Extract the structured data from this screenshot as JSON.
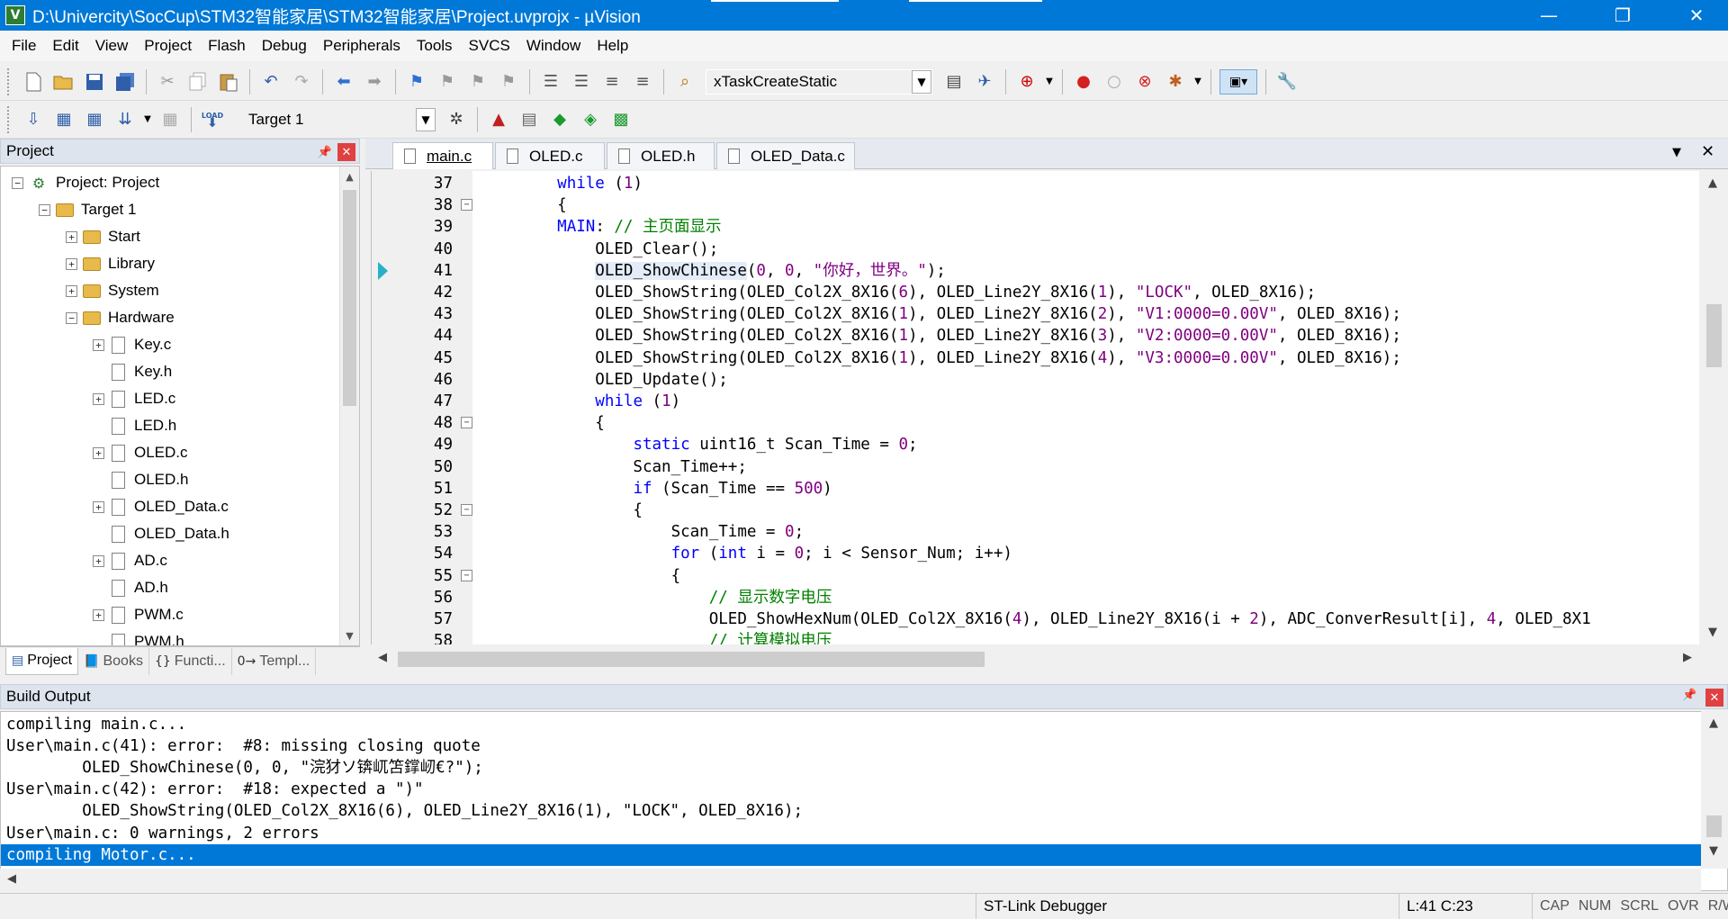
{
  "window": {
    "title": "D:\\Univercity\\SocCup\\STM32智能家居\\STM32智能家居\\Project.uvprojx - µVision",
    "logo_letter": "V",
    "minimize": "—",
    "restore": "❐",
    "close": "✕"
  },
  "menu": [
    "File",
    "Edit",
    "View",
    "Project",
    "Flash",
    "Debug",
    "Peripherals",
    "Tools",
    "SVCS",
    "Window",
    "Help"
  ],
  "toolbar1": {
    "find_combo_value": "xTaskCreateStatic"
  },
  "toolbar2": {
    "target_combo_value": "Target 1",
    "load_label": "LOAD"
  },
  "project_panel": {
    "title": "Project",
    "tree": [
      {
        "label": "Project: Project",
        "expander": "⊟",
        "type": "project"
      },
      {
        "label": "Target 1",
        "expander": "⊟",
        "type": "folder"
      },
      {
        "label": "Start",
        "expander": "+",
        "type": "folder"
      },
      {
        "label": "Library",
        "expander": "+",
        "type": "folder"
      },
      {
        "label": "System",
        "expander": "+",
        "type": "folder"
      },
      {
        "label": "Hardware",
        "expander": "−",
        "type": "folder"
      },
      {
        "label": "Key.c",
        "expander": "+",
        "type": "file"
      },
      {
        "label": "Key.h",
        "expander": "",
        "type": "file"
      },
      {
        "label": "LED.c",
        "expander": "+",
        "type": "file"
      },
      {
        "label": "LED.h",
        "expander": "",
        "type": "file"
      },
      {
        "label": "OLED.c",
        "expander": "+",
        "type": "file"
      },
      {
        "label": "OLED.h",
        "expander": "",
        "type": "file"
      },
      {
        "label": "OLED_Data.c",
        "expander": "+",
        "type": "file"
      },
      {
        "label": "OLED_Data.h",
        "expander": "",
        "type": "file"
      },
      {
        "label": "AD.c",
        "expander": "+",
        "type": "file"
      },
      {
        "label": "AD.h",
        "expander": "",
        "type": "file"
      },
      {
        "label": "PWM.c",
        "expander": "+",
        "type": "file"
      },
      {
        "label": "PWM.h",
        "expander": "",
        "type": "file"
      }
    ],
    "bottom_tabs": [
      "Project",
      "Books",
      "Functi...",
      "Templ..."
    ]
  },
  "editor": {
    "tabs": [
      "main.c",
      "OLED.c",
      "OLED.h",
      "OLED_Data.c"
    ],
    "active_tab": "main.c",
    "lines": [
      {
        "n": "37",
        "fold": "",
        "tokens": [
          {
            "t": "    "
          },
          {
            "t": "while",
            "c": "kw"
          },
          {
            "t": " ("
          },
          {
            "t": "1",
            "c": "num"
          },
          {
            "t": ")"
          }
        ]
      },
      {
        "n": "38",
        "fold": "−",
        "tokens": [
          {
            "t": "    {"
          }
        ]
      },
      {
        "n": "39",
        "fold": "",
        "tokens": [
          {
            "t": "    "
          },
          {
            "t": "MAIN",
            "c": "kw"
          },
          {
            "t": ": "
          },
          {
            "t": "// 主页面显示",
            "c": "cmt"
          }
        ]
      },
      {
        "n": "40",
        "fold": "",
        "tokens": [
          {
            "t": "        OLED_Clear();"
          }
        ]
      },
      {
        "n": "41",
        "fold": "",
        "marker": true,
        "tokens": [
          {
            "t": "        "
          },
          {
            "t": "OLED_ShowChinese",
            "c": "hl"
          },
          {
            "t": "("
          },
          {
            "t": "0",
            "c": "num"
          },
          {
            "t": ", "
          },
          {
            "t": "0",
            "c": "num"
          },
          {
            "t": ", "
          },
          {
            "t": "\"你好，世界。\"",
            "c": "str"
          },
          {
            "t": ");"
          }
        ]
      },
      {
        "n": "42",
        "fold": "",
        "tokens": [
          {
            "t": "        OLED_ShowString(OLED_Col2X_8X16("
          },
          {
            "t": "6",
            "c": "num"
          },
          {
            "t": "), OLED_Line2Y_8X16("
          },
          {
            "t": "1",
            "c": "num"
          },
          {
            "t": "), "
          },
          {
            "t": "\"LOCK\"",
            "c": "str"
          },
          {
            "t": ", OLED_8X16);"
          }
        ]
      },
      {
        "n": "43",
        "fold": "",
        "tokens": [
          {
            "t": "        OLED_ShowString(OLED_Col2X_8X16("
          },
          {
            "t": "1",
            "c": "num"
          },
          {
            "t": "), OLED_Line2Y_8X16("
          },
          {
            "t": "2",
            "c": "num"
          },
          {
            "t": "), "
          },
          {
            "t": "\"V1:0000=0.00V\"",
            "c": "str"
          },
          {
            "t": ", OLED_8X16);"
          }
        ]
      },
      {
        "n": "44",
        "fold": "",
        "tokens": [
          {
            "t": "        OLED_ShowString(OLED_Col2X_8X16("
          },
          {
            "t": "1",
            "c": "num"
          },
          {
            "t": "), OLED_Line2Y_8X16("
          },
          {
            "t": "3",
            "c": "num"
          },
          {
            "t": "), "
          },
          {
            "t": "\"V2:0000=0.00V\"",
            "c": "str"
          },
          {
            "t": ", OLED_8X16);"
          }
        ]
      },
      {
        "n": "45",
        "fold": "",
        "tokens": [
          {
            "t": "        OLED_ShowString(OLED_Col2X_8X16("
          },
          {
            "t": "1",
            "c": "num"
          },
          {
            "t": "), OLED_Line2Y_8X16("
          },
          {
            "t": "4",
            "c": "num"
          },
          {
            "t": "), "
          },
          {
            "t": "\"V3:0000=0.00V\"",
            "c": "str"
          },
          {
            "t": ", OLED_8X16);"
          }
        ]
      },
      {
        "n": "46",
        "fold": "",
        "tokens": [
          {
            "t": "        OLED_Update();"
          }
        ]
      },
      {
        "n": "47",
        "fold": "",
        "tokens": [
          {
            "t": "        "
          },
          {
            "t": "while",
            "c": "kw"
          },
          {
            "t": " ("
          },
          {
            "t": "1",
            "c": "num"
          },
          {
            "t": ")"
          }
        ]
      },
      {
        "n": "48",
        "fold": "−",
        "tokens": [
          {
            "t": "        {"
          }
        ]
      },
      {
        "n": "49",
        "fold": "",
        "tokens": [
          {
            "t": "            "
          },
          {
            "t": "static",
            "c": "kw"
          },
          {
            "t": " uint16_t Scan_Time = "
          },
          {
            "t": "0",
            "c": "num"
          },
          {
            "t": ";"
          }
        ]
      },
      {
        "n": "50",
        "fold": "",
        "tokens": [
          {
            "t": "            Scan_Time++;"
          }
        ]
      },
      {
        "n": "51",
        "fold": "",
        "tokens": [
          {
            "t": "            "
          },
          {
            "t": "if",
            "c": "kw"
          },
          {
            "t": " (Scan_Time == "
          },
          {
            "t": "500",
            "c": "num"
          },
          {
            "t": ")"
          }
        ]
      },
      {
        "n": "52",
        "fold": "−",
        "tokens": [
          {
            "t": "            {"
          }
        ]
      },
      {
        "n": "53",
        "fold": "",
        "tokens": [
          {
            "t": "                Scan_Time = "
          },
          {
            "t": "0",
            "c": "num"
          },
          {
            "t": ";"
          }
        ]
      },
      {
        "n": "54",
        "fold": "",
        "tokens": [
          {
            "t": "                "
          },
          {
            "t": "for",
            "c": "kw"
          },
          {
            "t": " ("
          },
          {
            "t": "int",
            "c": "kw"
          },
          {
            "t": " i = "
          },
          {
            "t": "0",
            "c": "num"
          },
          {
            "t": "; i < Sensor_Num; i++)"
          }
        ]
      },
      {
        "n": "55",
        "fold": "−",
        "tokens": [
          {
            "t": "                {"
          }
        ]
      },
      {
        "n": "56",
        "fold": "",
        "tokens": [
          {
            "t": "                    "
          },
          {
            "t": "// 显示数字电压",
            "c": "cmt"
          }
        ]
      },
      {
        "n": "57",
        "fold": "",
        "tokens": [
          {
            "t": "                    OLED_ShowHexNum(OLED_Col2X_8X16("
          },
          {
            "t": "4",
            "c": "num"
          },
          {
            "t": "), OLED_Line2Y_8X16(i + "
          },
          {
            "t": "2",
            "c": "num"
          },
          {
            "t": "), ADC_ConverResult[i], "
          },
          {
            "t": "4",
            "c": "num"
          },
          {
            "t": ", OLED_8X1"
          }
        ]
      },
      {
        "n": "58",
        "fold": "",
        "tokens": [
          {
            "t": "                    "
          },
          {
            "t": "// 计算模拟电压",
            "c": "cmt"
          }
        ]
      }
    ]
  },
  "build_output": {
    "title": "Build Output",
    "lines": [
      "compiling main.c...",
      "User\\main.c(41): error:  #8: missing closing quote",
      "        OLED_ShowChinese(0, 0, \"浣犲ソ锛屼笘鐣屻€?\");",
      "User\\main.c(42): error:  #18: expected a \")\"",
      "        OLED_ShowString(OLED_Col2X_8X16(6), OLED_Line2Y_8X16(1), \"LOCK\", OLED_8X16);",
      "User\\main.c: 0 warnings, 2 errors",
      "compiling Motor.c..."
    ],
    "selected_index": 6
  },
  "statusbar": {
    "debugger": "ST-Link Debugger",
    "position": "L:41 C:23",
    "indicators": [
      "CAP",
      "NUM",
      "SCRL",
      "OVR",
      "R/W"
    ]
  },
  "icons": {
    "new": "new-file-icon",
    "open": "open-folder-icon",
    "save": "save-icon",
    "save_all": "save-all-icon",
    "cut": "cut-icon",
    "copy": "copy-icon",
    "paste": "paste-icon",
    "undo": "undo-icon",
    "redo": "redo-icon",
    "back": "nav-back-icon",
    "forward": "nav-forward-icon"
  },
  "colors": {
    "titlebar": "#0078d7",
    "keyword": "#0000ff",
    "string": "#800080",
    "comment": "#008000",
    "selection": "#0078d7"
  }
}
